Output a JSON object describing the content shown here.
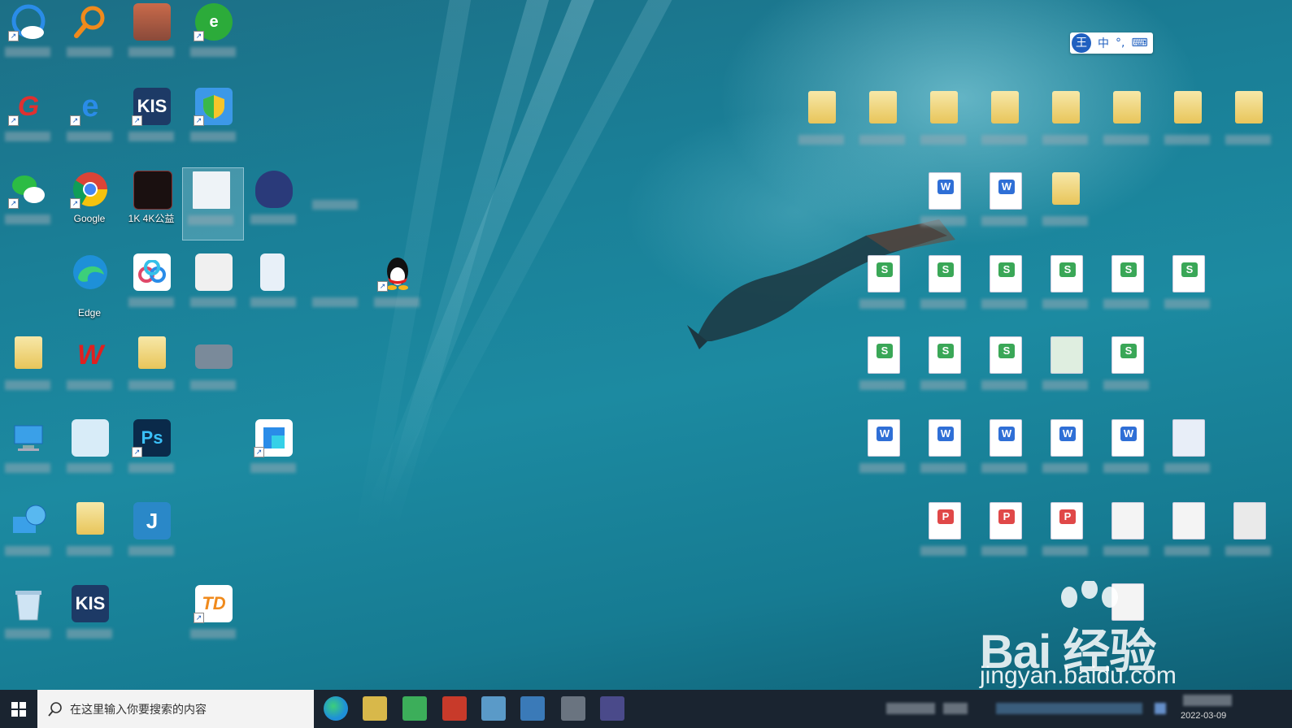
{
  "desktop": {
    "wallpaper": "underwater swimmer",
    "edge_label": "Edge",
    "partial_label_chrome": "Google",
    "partial_label_video": "1K 4K公益",
    "ps_text": "Ps",
    "kis_text": "KIS",
    "td_text": "TD"
  },
  "ime": {
    "logo": "王",
    "mode": "中",
    "punct": "°,",
    "keyboard_icon": "keyboard-icon"
  },
  "watermark": {
    "brand": "Bai  经验",
    "url": "jingyan.baidu.com"
  },
  "taskbar": {
    "search_placeholder": "在这里输入你要搜索的内容",
    "clock_date": "2022-03-09"
  },
  "colors": {
    "taskbar_bg": "#1a2430",
    "desktop_water": "#1a7f97",
    "search_bg": "#f3f3f3",
    "wps_s": "#3aa757",
    "wps_w": "#2f6fd6",
    "pdf": "#e04848"
  }
}
